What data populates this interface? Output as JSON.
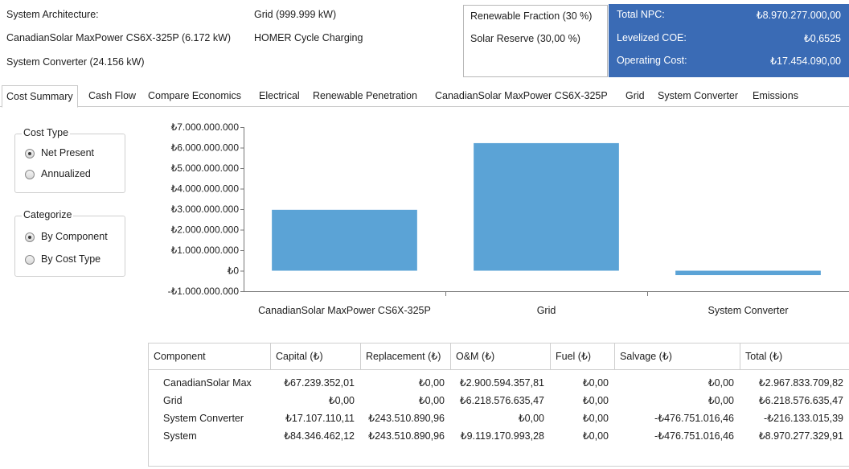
{
  "header": {
    "arch_label": "System Architecture:",
    "arch_pv": "CanadianSolar MaxPower CS6X-325P (6.172 kW)",
    "arch_converter": "System Converter (24.156 kW)",
    "arch_grid": "Grid (999.999 kW)",
    "arch_dispatch": "HOMER Cycle Charging",
    "renewable_fraction": "Renewable Fraction (30 %)",
    "solar_reserve": "Solar Reserve (30,00 %)",
    "total_npc_label": "Total NPC:",
    "total_npc_value": "₺8.970.277.000,00",
    "lcoe_label": "Levelized COE:",
    "lcoe_value": "₺0,6525",
    "opcost_label": "Operating Cost:",
    "opcost_value": "₺17.454.090,00",
    "accent_color": "#3a6bb5"
  },
  "tabs": [
    "Cost Summary",
    "Cash Flow",
    "Compare Economics",
    "Electrical",
    "Renewable Penetration",
    "CanadianSolar MaxPower CS6X-325P",
    "Grid",
    "System Converter",
    "Emissions"
  ],
  "active_tab": "Cost Summary",
  "cost_type": {
    "title": "Cost Type",
    "options": [
      "Net Present",
      "Annualized"
    ],
    "selected": "Net Present"
  },
  "categorize": {
    "title": "Categorize",
    "options": [
      "By Component",
      "By Cost Type"
    ],
    "selected": "By Component"
  },
  "chart_data": {
    "type": "bar",
    "categories": [
      "CanadianSolar MaxPower CS6X-325P",
      "Grid",
      "System Converter"
    ],
    "values": [
      2967833709.82,
      6218576635.47,
      -216133015.39
    ],
    "ylim": [
      -1000000000,
      7000000000
    ],
    "yticks": [
      "₺7.000.000.000",
      "₺6.000.000.000",
      "₺5.000.000.000",
      "₺4.000.000.000",
      "₺3.000.000.000",
      "₺2.000.000.000",
      "₺1.000.000.000",
      "₺0",
      "-₺1.000.000.000"
    ],
    "bar_color": "#5ba3d6",
    "grid": false
  },
  "table": {
    "headers": [
      "Component",
      "Capital (₺)",
      "Replacement (₺)",
      "O&M (₺)",
      "Fuel (₺)",
      "Salvage (₺)",
      "Total (₺)"
    ],
    "rows": [
      [
        "CanadianSolar Max",
        "₺67.239.352,01",
        "₺0,00",
        "₺2.900.594.357,81",
        "₺0,00",
        "₺0,00",
        "₺2.967.833.709,82"
      ],
      [
        "Grid",
        "₺0,00",
        "₺0,00",
        "₺6.218.576.635,47",
        "₺0,00",
        "₺0,00",
        "₺6.218.576.635,47"
      ],
      [
        "System Converter",
        "₺17.107.110,11",
        "₺243.510.890,96",
        "₺0,00",
        "₺0,00",
        "-₺476.751.016,46",
        "-₺216.133.015,39"
      ],
      [
        "System",
        "₺84.346.462,12",
        "₺243.510.890,96",
        "₺9.119.170.993,28",
        "₺0,00",
        "-₺476.751.016,46",
        "₺8.970.277.329,91"
      ]
    ]
  }
}
